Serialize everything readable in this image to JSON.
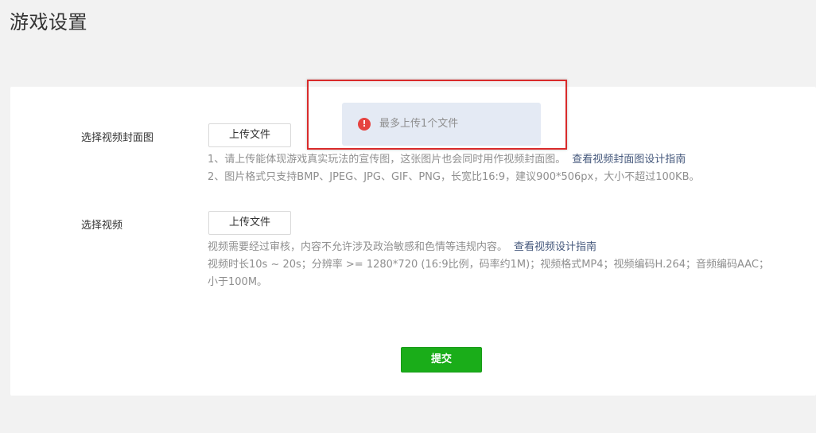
{
  "page": {
    "title": "游戏设置"
  },
  "cover": {
    "label": "选择视频封面图",
    "upload_label": "上传文件",
    "hint_1": "1、请上传能体现游戏真实玩法的宣传图，这张图片也会同时用作视频封面图。",
    "hint_1_link": "查看视频封面图设计指南",
    "hint_2": "2、图片格式只支持BMP、JPEG、JPG、GIF、PNG，长宽比16:9，建议900*506px，大小不超过100KB。"
  },
  "video": {
    "label": "选择视频",
    "upload_label": "上传文件",
    "hint_1": "视频需要经过审核，内容不允许涉及政治敏感和色情等违规内容。",
    "hint_1_link": "查看视频设计指南",
    "hint_2": "视频时长10s ~ 20s；分辨率 >= 1280*720 (16:9比例，码率约1M)；视频格式MP4；视频编码H.264；音频编码AAC；",
    "hint_3": "小于100M。"
  },
  "actions": {
    "submit_label": "提交"
  },
  "toast": {
    "icon": "error-icon",
    "icon_glyph": "!",
    "message": "最多上传1个文件"
  },
  "colors": {
    "primary_green": "#1aad19",
    "link": "#45587c",
    "error_red": "#e64340",
    "highlight_border": "#d92b2b",
    "toast_bg": "#e4eaf4"
  }
}
